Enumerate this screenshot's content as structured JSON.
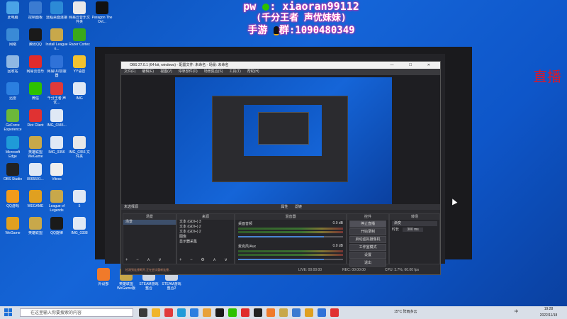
{
  "overlay": {
    "line1_prefix": "pw",
    "line1_text": ": xiaoran99112",
    "line2": "(千分王者 声优妹妹)",
    "line3_prefix": "手游",
    "line3_text": "群:1090480349"
  },
  "live_badge": "直播",
  "desktop_icons": [
    {
      "label": "此电脑",
      "color": "#4aa3e6"
    },
    {
      "label": "控制面板",
      "color": "#3b7bd1"
    },
    {
      "label": "远程桌面连接",
      "color": "#2c8ad6"
    },
    {
      "label": "网易云音乐文件夹",
      "color": "#e9e9e9"
    },
    {
      "label": "Paragon The Ovt...",
      "color": "#111111"
    },
    {
      "label": "网络",
      "color": "#3a8ad6"
    },
    {
      "label": "腾讯QQ",
      "color": "#1a1a1a"
    },
    {
      "label": "Install League o...",
      "color": "#c8a84a"
    },
    {
      "label": "Razer Cortex",
      "color": "#3aa81a"
    },
    {
      "label": "回收站",
      "color": "#8fb7e3"
    },
    {
      "label": "网易云音乐",
      "color": "#e02b2b"
    },
    {
      "label": "网易UU加速器",
      "color": "#2f72d8"
    },
    {
      "label": "YY语音",
      "color": "#f2c230"
    },
    {
      "label": "迅雷",
      "color": "#2b7fe0"
    },
    {
      "label": "微信",
      "color": "#2dc100"
    },
    {
      "label": "千分王者 声优...",
      "color": "#e03a3a"
    },
    {
      "label": "IMG",
      "color": "#dfe8f5"
    },
    {
      "label": "GeForce Experience",
      "color": "#6cb83a"
    },
    {
      "label": "Riot Client",
      "color": "#e03232"
    },
    {
      "label": "IMG_0345...",
      "color": "#dfe8f5"
    },
    {
      "label": "Microsoft Edge",
      "color": "#1f9bd8"
    },
    {
      "label": "英雄联盟WeGame",
      "color": "#c8a84a"
    },
    {
      "label": "IMG_0356",
      "color": "#dfe8f5"
    },
    {
      "label": "IMG_0356 文件夹",
      "color": "#e8e8e8"
    },
    {
      "label": "OBS Studio",
      "color": "#222222"
    },
    {
      "label": "8065591...",
      "color": "#dfe8f5"
    },
    {
      "label": "Vitess",
      "color": "#eeeeee"
    },
    {
      "label": "QQ游戏",
      "color": "#f29b1b"
    },
    {
      "label": "WEGAME",
      "color": "#e0a020"
    },
    {
      "label": "League of Legends",
      "color": "#c8a84a"
    },
    {
      "label": "5",
      "color": "#dfe8f5"
    },
    {
      "label": "WeGame",
      "color": "#e0a020"
    },
    {
      "label": "英雄联盟",
      "color": "#c8a84a"
    },
    {
      "label": "QQ旋律",
      "color": "#1a1a1a"
    },
    {
      "label": "IMG_0338",
      "color": "#dfe8f5"
    },
    {
      "label": "外设部",
      "color": "#f07a2a"
    },
    {
      "label": "英雄联盟WeGame版",
      "color": "#c8a84a"
    },
    {
      "label": "STEAM游戏整合",
      "color": "#cfd6e2"
    },
    {
      "label": "STEAM游戏整合2",
      "color": "#cfd6e2"
    }
  ],
  "obs": {
    "title": "OBS 27.0.1 (64-bit, windows) - 配置文件: 未命名 - 场景: 未命名",
    "window_controls": "— ☐ ✕",
    "menu": [
      "文件(F)",
      "编辑(E)",
      "视图(V)",
      "停靠部件(D)",
      "场景集合(S)",
      "工具(T)",
      "帮助(H)"
    ],
    "dock_title": "未选择源",
    "dock_tabs": [
      "属性",
      "滤镜"
    ],
    "panels": {
      "scenes": {
        "header": "场景",
        "items": [
          "场景"
        ]
      },
      "sources": {
        "header": "来源",
        "items": [
          "文本 (GDI+) 3",
          "文本 (GDI+) 2",
          "文本 (GDI+) 2",
          "图像",
          "显示器采集"
        ]
      },
      "mixer": {
        "header": "混音器",
        "tracks": [
          {
            "name": "桌面音频",
            "db": "0.0 dB"
          },
          {
            "name": "麦克风/Aux",
            "db": "0.0 dB"
          }
        ]
      },
      "transitions": {
        "header": "转场",
        "type": "渐变",
        "duration_label": "时长",
        "duration": "300 ms"
      },
      "controls": {
        "header": "控件",
        "buttons": [
          "停止直播",
          "开始录制",
          "启动虚拟摄像机",
          "工作室模式",
          "设置",
          "退出"
        ]
      }
    },
    "status": {
      "live": "LIVE: 00:00:00",
      "rec": "REC: 00:00:00",
      "cpu": "CPU: 3.7%, 60.00 fps",
      "warning": "检测到连接断开,正在尝试重新连接..."
    }
  },
  "taskbar": {
    "search_placeholder": "在这里输入你要搜索的内容",
    "weather": "15°C 阵雨多云",
    "time": "19:28",
    "date": "2022/11/18",
    "lang": "中"
  }
}
